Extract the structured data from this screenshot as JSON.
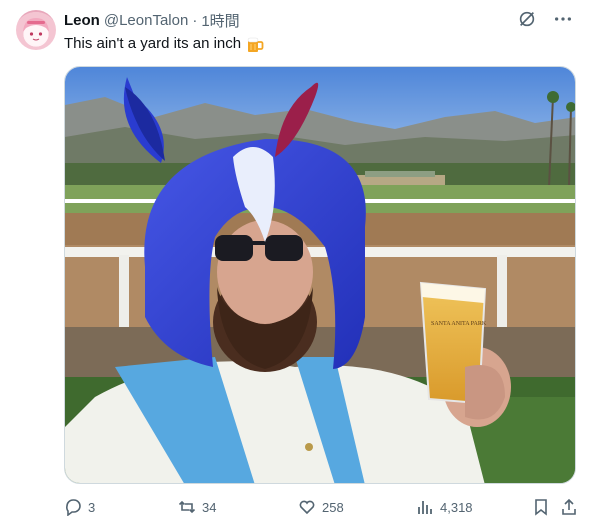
{
  "tweet": {
    "author": {
      "name": "Leon",
      "handle": "@LeonTalon",
      "separator": "·",
      "time": "1時間"
    },
    "text": "This ain't a yard its an inch",
    "emoji": "beer-mug",
    "media": {
      "sign_text": "SANTA ANITA PARK"
    },
    "metrics": {
      "replies": "3",
      "retweets": "34",
      "likes": "258",
      "views": "4,318"
    },
    "icons": [
      "grok-icon",
      "more-icon",
      "reply-icon",
      "retweet-icon",
      "like-icon",
      "views-icon",
      "bookmark-icon",
      "share-icon"
    ]
  }
}
